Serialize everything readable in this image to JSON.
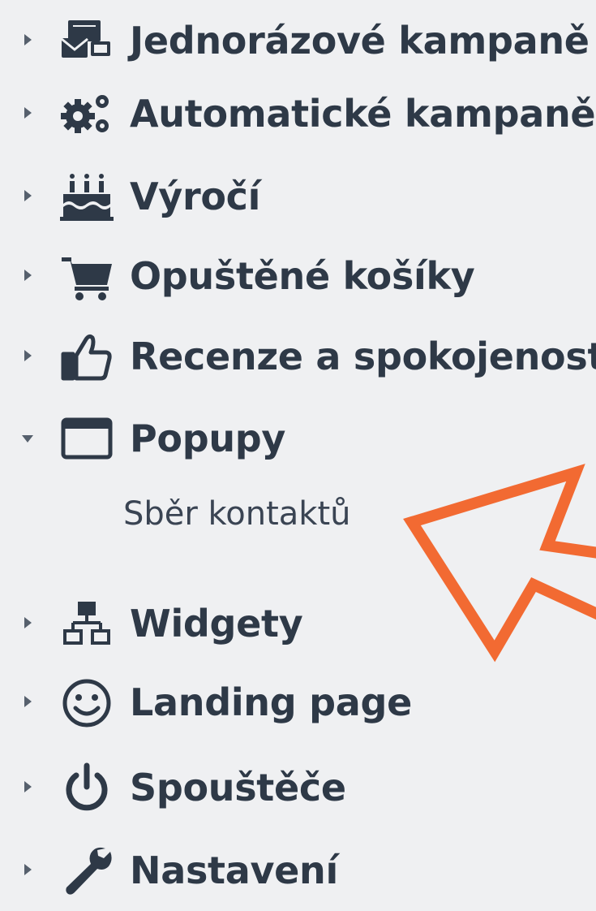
{
  "menu": {
    "items": [
      {
        "label": "Jednorázové kampaně",
        "icon": "envelopes-icon",
        "expanded": false
      },
      {
        "label": "Automatické kampaně",
        "icon": "gears-icon",
        "expanded": false
      },
      {
        "label": "Výročí",
        "icon": "birthday-cake-icon",
        "expanded": false
      },
      {
        "label": "Opuštěné košíky",
        "icon": "shopping-cart-icon",
        "expanded": false
      },
      {
        "label": "Recenze a spokojenost",
        "icon": "thumbs-up-icon",
        "expanded": false
      },
      {
        "label": "Popupy",
        "icon": "window-icon",
        "expanded": true
      },
      {
        "label": "Widgety",
        "icon": "sitemap-icon",
        "expanded": false
      },
      {
        "label": "Landing page",
        "icon": "smiley-icon",
        "expanded": false
      },
      {
        "label": "Spouštěče",
        "icon": "power-icon",
        "expanded": false
      },
      {
        "label": "Nastavení",
        "icon": "wrench-icon",
        "expanded": false
      }
    ],
    "subitems": {
      "popupy": [
        {
          "label": "Sběr kontaktů"
        }
      ]
    }
  },
  "colors": {
    "background": "#eff0f2",
    "text": "#2e3947",
    "caret": "#56606d",
    "arrow": "#f26a32"
  }
}
